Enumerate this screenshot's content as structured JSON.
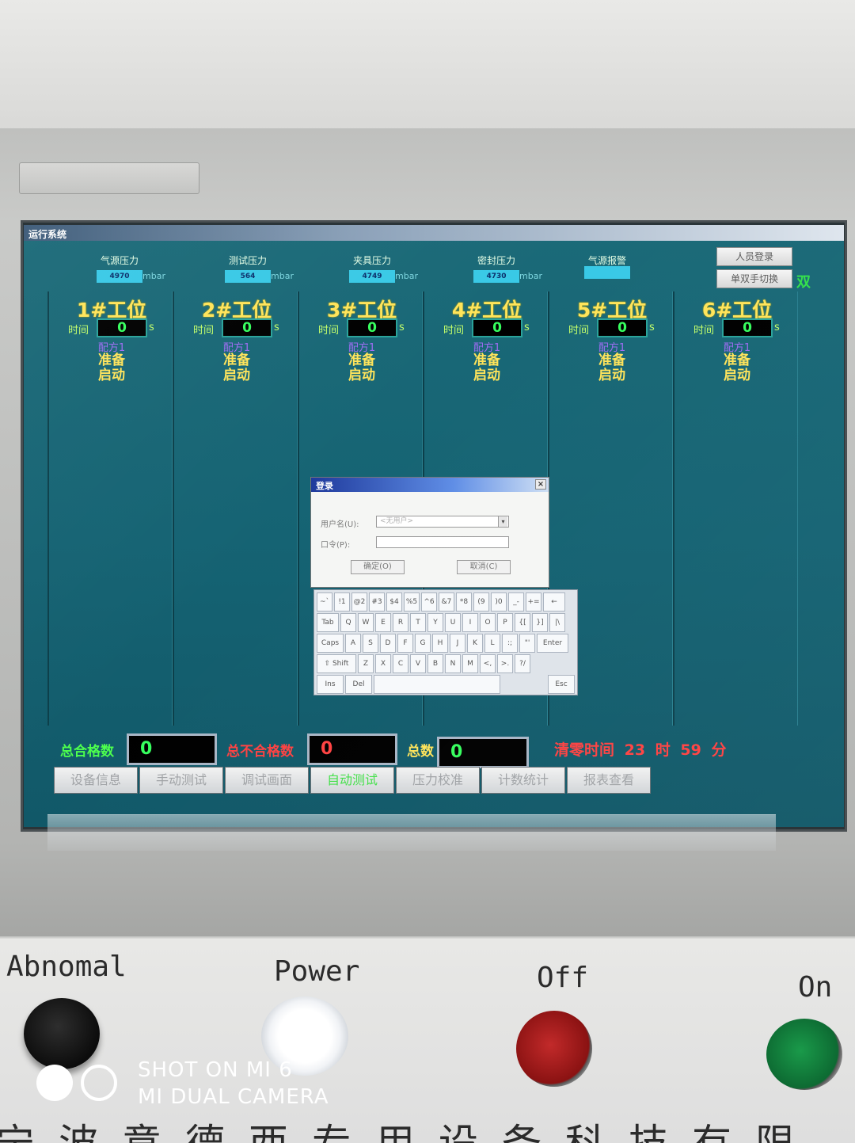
{
  "hmi": {
    "window_title": "运行系统",
    "gauges": [
      {
        "label": "气源压力",
        "value": "4970",
        "unit": "mbar"
      },
      {
        "label": "测试压力",
        "value": "564",
        "unit": "mbar"
      },
      {
        "label": "夹具压力",
        "value": "4749",
        "unit": "mbar"
      },
      {
        "label": "密封压力",
        "value": "4730",
        "unit": "mbar"
      },
      {
        "label": "气源报警",
        "value": "",
        "unit": ""
      }
    ],
    "login_button": "人员登录",
    "switch_button": "单双手切换",
    "mode_indicator": "双",
    "stations": [
      {
        "title": "1#工位",
        "time_label": "时间",
        "time_value": "0",
        "time_unit": "s",
        "recipe": "配方1",
        "status_line1": "准备",
        "status_line2": "启动"
      },
      {
        "title": "2#工位",
        "time_label": "时间",
        "time_value": "0",
        "time_unit": "s",
        "recipe": "配方1",
        "status_line1": "准备",
        "status_line2": "启动"
      },
      {
        "title": "3#工位",
        "time_label": "时间",
        "time_value": "0",
        "time_unit": "s",
        "recipe": "配方1",
        "status_line1": "准备",
        "status_line2": "启动"
      },
      {
        "title": "4#工位",
        "time_label": "时间",
        "time_value": "0",
        "time_unit": "s",
        "recipe": "配方1",
        "status_line1": "准备",
        "status_line2": "启动"
      },
      {
        "title": "5#工位",
        "time_label": "时间",
        "time_value": "0",
        "time_unit": "s",
        "recipe": "配方1",
        "status_line1": "准备",
        "status_line2": "启动"
      },
      {
        "title": "6#工位",
        "time_label": "时间",
        "time_value": "0",
        "time_unit": "s",
        "recipe": "配方1",
        "status_line1": "准备",
        "status_line2": "启动"
      }
    ],
    "login_dialog": {
      "title": "登录",
      "close_glyph": "×",
      "username_label": "用户名(U):",
      "username_value": "<无用户>",
      "password_label": "口令(P):",
      "password_value": "",
      "ok_label": "确定(O)",
      "cancel_label": "取消(C)"
    },
    "keyboard": {
      "rows": [
        [
          "~`",
          "!1",
          "@2",
          "#3",
          "$4",
          "%5",
          "^6",
          "&7",
          "*8",
          "(9",
          ")0",
          "_-",
          "+=",
          "←"
        ],
        [
          "Tab",
          "Q",
          "W",
          "E",
          "R",
          "T",
          "Y",
          "U",
          "I",
          "O",
          "P",
          "{[",
          "}]",
          "|\\"
        ],
        [
          "Caps",
          "A",
          "S",
          "D",
          "F",
          "G",
          "H",
          "J",
          "K",
          "L",
          ":;",
          "\"'",
          "Enter"
        ],
        [
          "⇧ Shift",
          "Z",
          "X",
          "C",
          "V",
          "B",
          "N",
          "M",
          "<,",
          ">.",
          "?/"
        ],
        [
          "Ins",
          "Del",
          " ",
          "Esc"
        ]
      ]
    },
    "counters": {
      "pass_label": "总合格数",
      "pass_value": "0",
      "fail_label": "总不合格数",
      "fail_value": "0",
      "total_label": "总数",
      "total_value": "0",
      "clear_label": "清零时间",
      "clear_hour": "23",
      "hour_unit": "时",
      "clear_minute": "59",
      "minute_unit": "分"
    },
    "nav": [
      {
        "label": "设备信息",
        "active": false
      },
      {
        "label": "手动测试",
        "active": false
      },
      {
        "label": "调试画面",
        "active": false
      },
      {
        "label": "自动测试",
        "active": true
      },
      {
        "label": "压力校准",
        "active": false
      },
      {
        "label": "计数统计",
        "active": false
      },
      {
        "label": "报表查看",
        "active": false
      }
    ]
  },
  "panel": {
    "abnormal_label": "Abnomal",
    "power_label": "Power",
    "off_label": "Off",
    "on_label": "On"
  },
  "watermark": {
    "line1": "SHOT ON MI 6",
    "line2": "MI DUAL CAMERA"
  },
  "bottom_text": "宁波意德西专用设备科技有限"
}
